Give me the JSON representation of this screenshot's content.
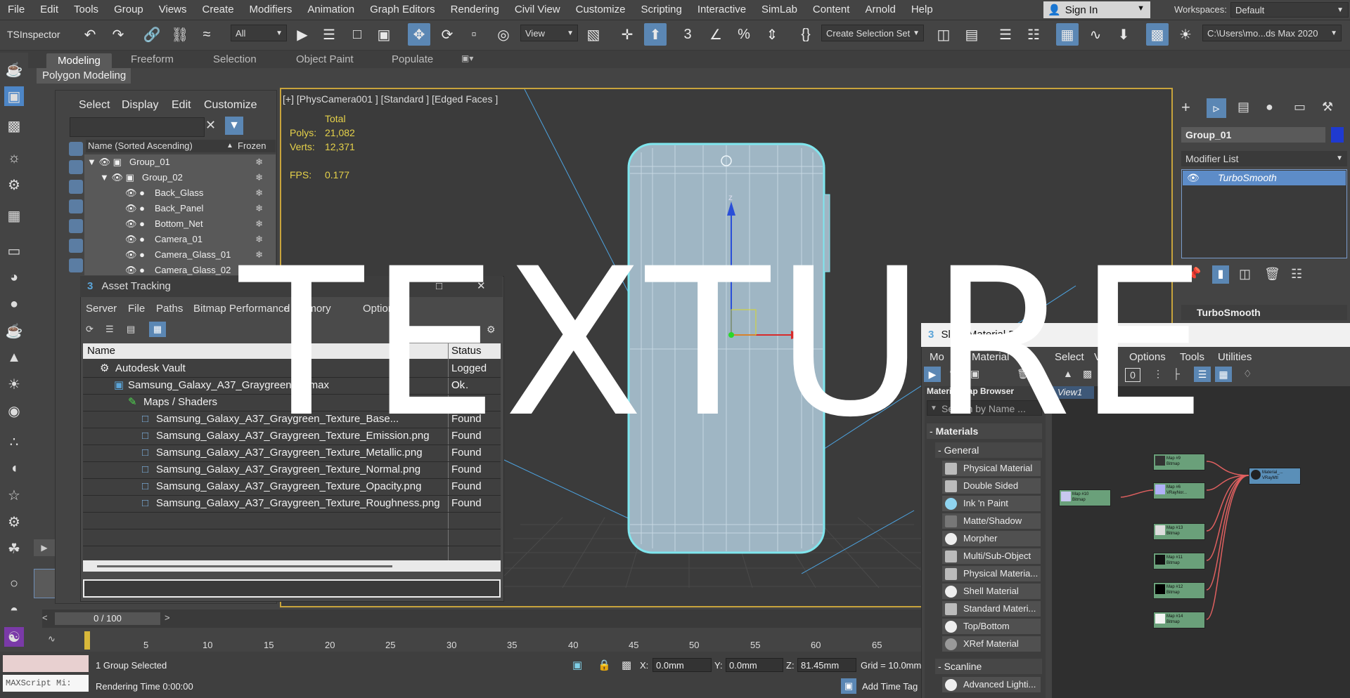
{
  "menu": [
    "File",
    "Edit",
    "Tools",
    "Group",
    "Views",
    "Create",
    "Modifiers",
    "Animation",
    "Graph Editors",
    "Rendering",
    "Civil View",
    "Customize",
    "Scripting",
    "Interactive",
    "SimLab",
    "Content",
    "Arnold",
    "Help"
  ],
  "signin": "Sign In",
  "workspaces": {
    "label": "Workspaces:",
    "value": "Default"
  },
  "toolbar": {
    "inspector": "TSInspector",
    "filter": "All",
    "view": "View",
    "selection_set": "Create Selection Set",
    "path": "C:\\Users\\mo...ds Max 2020"
  },
  "ribbon": {
    "tabs": [
      "Modeling",
      "Freeform",
      "Selection",
      "Object Paint",
      "Populate"
    ],
    "sub": "Polygon Modeling"
  },
  "explorer": {
    "menu": [
      "Select",
      "Display",
      "Edit",
      "Customize"
    ],
    "col_name": "Name (Sorted Ascending)",
    "col_frozen": "Frozen",
    "rows": [
      "Group_01",
      "Group_02",
      "Back_Glass",
      "Back_Panel",
      "Bottom_Net",
      "Camera_01",
      "Camera_Glass_01",
      "Camera_Glass_02"
    ]
  },
  "viewport": {
    "label": "[+] [PhysCamera001 ] [Standard ] [Edged Faces ]",
    "stats": {
      "total": "Total",
      "polys_label": "Polys:",
      "polys": "21,082",
      "verts_label": "Verts:",
      "verts": "12,371",
      "fps_label": "FPS:",
      "fps": "0.177"
    },
    "axis_z": "z",
    "axis_x": "x"
  },
  "command_panel": {
    "object_name": "Group_01",
    "object_color": "#1f3ad0",
    "modifier_list": "Modifier List",
    "modifier": "TurboSmooth",
    "rollout": "TurboSmooth"
  },
  "asset_tracking": {
    "title": "Asset Tracking",
    "menu": [
      "Server",
      "File",
      "Paths",
      "Bitmap Performance",
      "d Memory",
      "Options"
    ],
    "col_name": "Name",
    "col_status": "Status",
    "rows": [
      {
        "name": "Autodesk Vault",
        "status": "Logged O..."
      },
      {
        "name": "Samsung_Galaxy_A37_Graygreen_....max",
        "status": "Ok"
      },
      {
        "name": "Maps / Shaders",
        "status": ""
      },
      {
        "name": "Samsung_Galaxy_A37_Graygreen_Texture_Base...",
        "status": "Found"
      },
      {
        "name": "Samsung_Galaxy_A37_Graygreen_Texture_Emission.png",
        "status": "Found"
      },
      {
        "name": "Samsung_Galaxy_A37_Graygreen_Texture_Metallic.png",
        "status": "Found"
      },
      {
        "name": "Samsung_Galaxy_A37_Graygreen_Texture_Normal.png",
        "status": "Found"
      },
      {
        "name": "Samsung_Galaxy_A37_Graygreen_Texture_Opacity.png",
        "status": "Found"
      },
      {
        "name": "Samsung_Galaxy_A37_Graygreen_Texture_Roughness.png",
        "status": "Found"
      }
    ]
  },
  "slate": {
    "title": "Slate Material Ed",
    "menu": [
      "Mo",
      "Material",
      "E",
      "Select",
      "View",
      "Options",
      "Tools",
      "Utilities"
    ],
    "browser_title": "Material/Map Browser",
    "search": "Search by Name ...",
    "materials_header": "Materials",
    "general_header": "General",
    "materials": [
      "Physical Material",
      "Double Sided",
      "Ink 'n Paint",
      "Matte/Shadow",
      "Morpher",
      "Multi/Sub-Object",
      "Physical Materia...",
      "Shell Material",
      "Standard Materi...",
      "Top/Bottom",
      "XRef Material"
    ],
    "scanline_header": "Scanline",
    "scanline_first": "Advanced Lighti...",
    "view_tab": "View1",
    "zero_btn": "0",
    "nodes": [
      {
        "label": "Map #10",
        "sub": "Bitmap"
      },
      {
        "label": "Map #9",
        "sub": "Bitmap"
      },
      {
        "label": "Map #6",
        "sub": "VRayNor..."
      },
      {
        "label": "Map #13",
        "sub": "Bitmap"
      },
      {
        "label": "Map #11",
        "sub": "Bitmap"
      },
      {
        "label": "Map #12",
        "sub": "Bitmap"
      },
      {
        "label": "Map #14",
        "sub": "Bitmap"
      },
      {
        "label": "Material_...",
        "sub": "VRayMtl"
      }
    ]
  },
  "timeline": {
    "frame": "0 / 100",
    "ticks": [
      "5",
      "10",
      "15",
      "20",
      "25",
      "30",
      "35",
      "40",
      "45",
      "50",
      "55",
      "60",
      "65"
    ]
  },
  "status": {
    "selected": "1 Group Selected",
    "render_time": "Rendering Time  0:00:00",
    "x_label": "X:",
    "x": "0.0mm",
    "y_label": "Y:",
    "y": "0.0mm",
    "z_label": "Z:",
    "z": "81.45mm",
    "grid": "Grid = 10.0mm",
    "add_time_tag": "Add Time Tag",
    "maxscript": "MAXScript Mi:"
  },
  "watermark": "TEXTURE"
}
